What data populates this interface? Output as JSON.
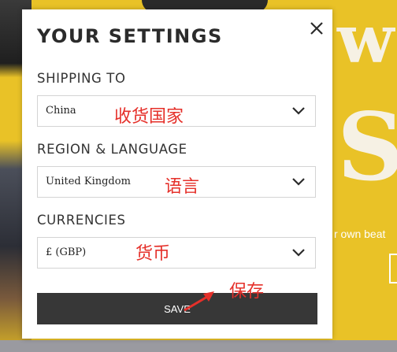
{
  "modal": {
    "title": "YOUR SETTINGS",
    "close_icon": "close-icon"
  },
  "shipping": {
    "label": "SHIPPING TO",
    "value": "China",
    "annotation": "收货国家"
  },
  "region": {
    "label": "REGION & LANGUAGE",
    "value": "United Kingdom",
    "annotation": "语言"
  },
  "currency": {
    "label": "CURRENCIES",
    "value": "£ (GBP)",
    "annotation": "货币"
  },
  "save": {
    "label": "SAVE",
    "annotation": "保存"
  },
  "background": {
    "tagline": "r own beat",
    "script_top": "w",
    "script_mid": "So"
  },
  "colors": {
    "accent_yellow": "#e9c227",
    "button_dark": "#373737",
    "annotation_red": "#e5302a"
  }
}
